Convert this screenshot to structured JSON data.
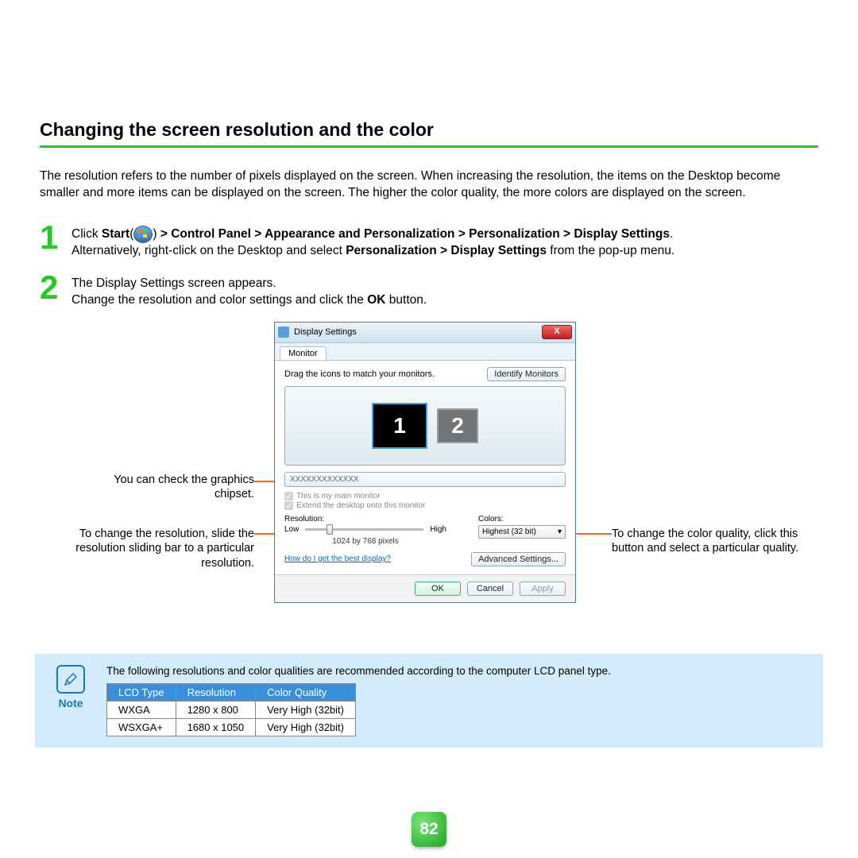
{
  "title": "Changing the screen resolution and the color",
  "intro": "The resolution refers to the number of pixels displayed on the screen. When increasing the resolution, the items on the Desktop become smaller and more items can be displayed on the screen. The higher the color quality, the more colors are displayed on the screen.",
  "steps": {
    "s1": {
      "num": "1",
      "pre": "Click ",
      "bold1": "Start",
      "mid1": "(",
      "mid2": ") ",
      "path": "> Control Panel > Appearance and Personalization > Personalization > Display Settings",
      "after": ".",
      "line2a": "Alternatively, right-click on the Desktop and select ",
      "line2b": "Personalization > Display Settings",
      "line2c": " from the pop-up menu."
    },
    "s2": {
      "num": "2",
      "line1": "The Display Settings screen appears.",
      "line2a": "Change the resolution and color settings and click the ",
      "line2b": "OK",
      "line2c": " button."
    }
  },
  "callouts": {
    "chipset": "You can check the graphics chipset.",
    "resolution": "To change the resolution, slide the resolution sliding bar to a particular resolution.",
    "color": "To change the color quality, click this button and select a particular quality."
  },
  "dialog": {
    "title": "Display Settings",
    "tab": "Monitor",
    "drag": "Drag the icons to match your monitors.",
    "identify": "Identify Monitors",
    "mon1": "1",
    "mon2": "2",
    "chipset": "XXXXXXXXXXXXX",
    "chk1": "This is my main monitor",
    "chk2": "Extend the desktop onto this monitor",
    "res_label": "Resolution:",
    "low": "Low",
    "high": "High",
    "res_value": "1024 by 768 pixels",
    "col_label": "Colors:",
    "col_value": "Highest (32 bit)",
    "help": "How do I get the best display?",
    "adv": "Advanced Settings...",
    "ok": "OK",
    "cancel": "Cancel",
    "apply": "Apply"
  },
  "note": {
    "label": "Note",
    "text": "The following resolutions and color qualities are recommended according to the computer LCD panel type.",
    "headers": [
      "LCD Type",
      "Resolution",
      "Color Quality"
    ],
    "rows": [
      [
        "WXGA",
        "1280 x 800",
        "Very High (32bit)"
      ],
      [
        "WSXGA+",
        "1680 x 1050",
        "Very High (32bit)"
      ]
    ]
  },
  "page_number": "82"
}
